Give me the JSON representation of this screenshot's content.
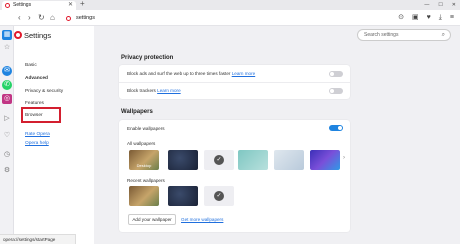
{
  "tab": {
    "title": "Settings",
    "close": "✕"
  },
  "newtab": "+",
  "window_controls": [
    "—",
    "☐",
    "✕"
  ],
  "addressbar": {
    "back": "‹",
    "forward": "›",
    "reload": "↻",
    "home": "⌂",
    "url": "settings"
  },
  "toolbar_icons": [
    "camera-icon",
    "snapshot-icon",
    "heart-icon",
    "download-icon",
    "menu-icon"
  ],
  "sidebar_icons": [
    {
      "name": "opera-logo",
      "color": "#e0192c"
    },
    {
      "name": "speed-dial-icon",
      "color": "#1f84e0"
    },
    {
      "name": "star-icon",
      "color": "#777777"
    },
    {
      "name": "messenger-icon",
      "color": "#1f84e0"
    },
    {
      "name": "whatsapp-icon",
      "color": "#25d366"
    },
    {
      "name": "instagram-icon",
      "color": "#c13584"
    },
    {
      "name": "send-icon",
      "color": "#777777"
    },
    {
      "name": "heart-icon",
      "color": "#777777"
    },
    {
      "name": "history-icon",
      "color": "#777777"
    },
    {
      "name": "gear-icon",
      "color": "#777777"
    }
  ],
  "header": {
    "title": "Settings",
    "search_placeholder": "Search settings"
  },
  "nav": {
    "basic": "Basic",
    "advanced": "Advanced",
    "items": [
      "Privacy & security",
      "Features",
      "Browser"
    ],
    "rate": "Rate Opera",
    "help": "Opera help"
  },
  "privacy": {
    "title": "Privacy protection",
    "row1_text": "Block ads and surf the web up to three times faster",
    "row1_link": "Learn more",
    "row1_enabled": false,
    "row2_text": "Block trackers",
    "row2_link": "Learn more",
    "row2_enabled": false
  },
  "wallpapers": {
    "title": "Wallpapers",
    "enable_label": "Enable wallpapers",
    "enabled": true,
    "all_label": "All wallpapers",
    "recent_label": "Recent wallpapers",
    "thumb_desktop_label": "Desktop",
    "add_button": "Add your wallpaper",
    "get_more": "Get more wallpapers",
    "next": "›",
    "check": "✓"
  },
  "status_url": "opera://settings/startPage"
}
